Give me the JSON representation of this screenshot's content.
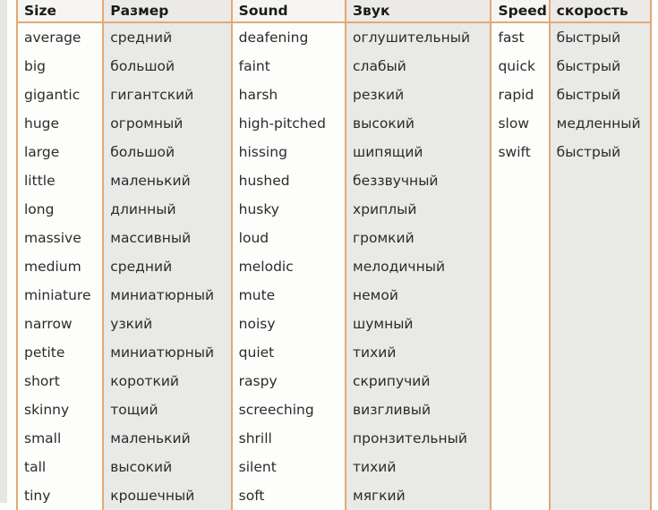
{
  "table": {
    "headers": [
      {
        "label": "Size",
        "lang": "en"
      },
      {
        "label": "Размер",
        "lang": "ru"
      },
      {
        "label": "Sound",
        "lang": "en"
      },
      {
        "label": "Звук",
        "lang": "ru"
      },
      {
        "label": "Speed",
        "lang": "en"
      },
      {
        "label": "скорость",
        "lang": "ru"
      }
    ],
    "rows": [
      [
        "average",
        "средний",
        "deafening",
        "оглушительный",
        "fast",
        "быстрый"
      ],
      [
        "big",
        "большой",
        "faint",
        "слабый",
        "quick",
        "быстрый"
      ],
      [
        "gigantic",
        "гигантский",
        "harsh",
        "резкий",
        "rapid",
        "быстрый"
      ],
      [
        "huge",
        "огромный",
        "high-pitched",
        "высокий",
        "slow",
        "медленный"
      ],
      [
        "large",
        "большой",
        "hissing",
        "шипящий",
        "swift",
        "быстрый"
      ],
      [
        "little",
        "маленький",
        "hushed",
        "беззвучный",
        "",
        ""
      ],
      [
        "long",
        "длинный",
        "husky",
        "хриплый",
        "",
        ""
      ],
      [
        "massive",
        "массивный",
        "loud",
        "громкий",
        "",
        ""
      ],
      [
        "medium",
        "средний",
        "melodic",
        "мелодичный",
        "",
        ""
      ],
      [
        "miniature",
        "миниатюрный",
        "mute",
        "немой",
        "",
        ""
      ],
      [
        "narrow",
        "узкий",
        "noisy",
        "шумный",
        "",
        ""
      ],
      [
        "petite",
        "миниатюрный",
        "quiet",
        "тихий",
        "",
        ""
      ],
      [
        "short",
        "короткий",
        "raspy",
        "скрипучий",
        "",
        ""
      ],
      [
        "skinny",
        "тощий",
        "screeching",
        "визгливый",
        "",
        ""
      ],
      [
        "small",
        "маленький",
        "shrill",
        "пронзительный",
        "",
        ""
      ],
      [
        "tall",
        "высокий",
        "silent",
        "тихий",
        "",
        ""
      ],
      [
        "tiny",
        "крошечный",
        "soft",
        "мягкий",
        "",
        ""
      ]
    ],
    "column_langs": [
      "en",
      "ru",
      "en",
      "ru",
      "en",
      "ru"
    ],
    "colors": {
      "border": "#e0aa74",
      "header_en_bg": "#f7f5f1",
      "header_ru_bg": "#eceae6",
      "cell_en_bg": "#fdfdfb",
      "cell_ru_bg": "#e9e9e7",
      "text": "#2b2b2b",
      "header_text": "#1a1a1a",
      "gutter": "#e6e6e4"
    }
  }
}
